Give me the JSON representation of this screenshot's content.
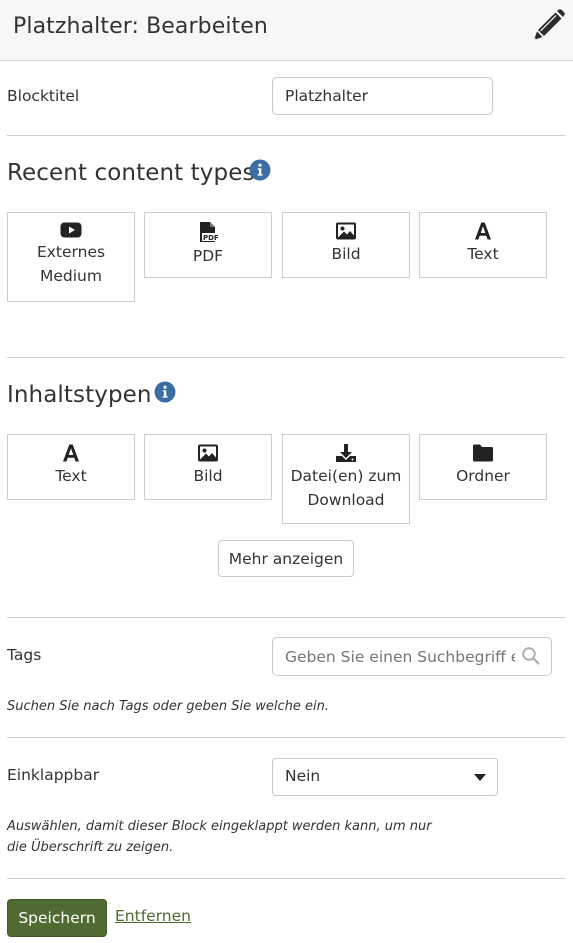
{
  "header": {
    "title": "Platzhalter: Bearbeiten",
    "edit_icon": "pencil-icon"
  },
  "block_title": {
    "label": "Blocktitel",
    "value": "Platzhalter"
  },
  "recent_content_types": {
    "heading": "Recent content types",
    "info_icon": "info-icon",
    "items": [
      {
        "label": "Externes Medium",
        "icon": "youtube-icon"
      },
      {
        "label": "PDF",
        "icon": "pdf-file-icon"
      },
      {
        "label": "Bild",
        "icon": "image-icon"
      },
      {
        "label": "Text",
        "icon": "text-icon"
      }
    ]
  },
  "content_types": {
    "heading": "Inhaltstypen",
    "info_icon": "info-icon",
    "items": [
      {
        "label": "Text",
        "icon": "text-icon"
      },
      {
        "label": "Bild",
        "icon": "image-icon"
      },
      {
        "label": "Datei(en) zum Download",
        "icon": "download-icon"
      },
      {
        "label": "Ordner",
        "icon": "folder-icon"
      }
    ],
    "more_label": "Mehr anzeigen"
  },
  "tags": {
    "label": "Tags",
    "placeholder": "Geben Sie einen Suchbegriff ein",
    "help": "Suchen Sie nach Tags oder geben Sie welche ein."
  },
  "collapsible": {
    "label": "Einklappbar",
    "selected": "Nein",
    "help": "Auswählen, damit dieser Block eingeklappt werden kann, um nur die Überschrift zu zeigen."
  },
  "actions": {
    "save_label": "Speichern",
    "remove_label": "Entfernen"
  },
  "colors": {
    "primary": "#4f6b32",
    "info": "#3a6ea5",
    "header_bg": "#f7f7f8"
  }
}
